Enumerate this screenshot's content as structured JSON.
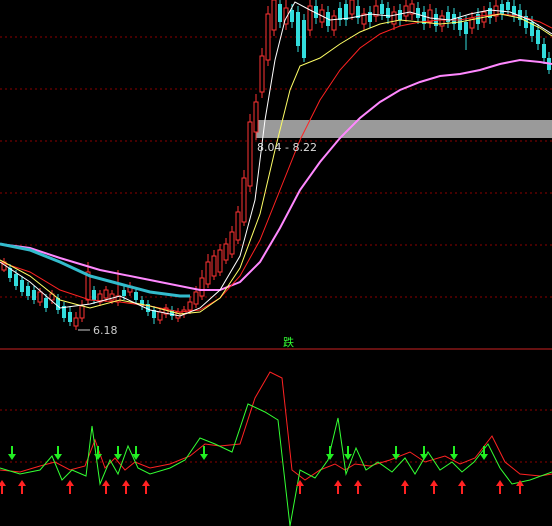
{
  "chart_data": [
    {
      "type": "candlestick",
      "panel": "price",
      "annotations": {
        "low_price_label": "6.18",
        "range_label": "8.04 - 8.22"
      },
      "colors": {
        "up": "#ff3333",
        "down": "#33dddd",
        "ma_fast": "#ffffff",
        "ma_mid": "#ffff66",
        "ma_slow": "#ff2222",
        "ma_long": "#ff88ff",
        "ma_ext": "#33bbcc",
        "grid": "#8b0000",
        "highlight_band": "#9a9a9a"
      }
    },
    {
      "type": "line",
      "panel": "indicator",
      "divider_label": "跌",
      "colors": {
        "line_a": "#33ff33",
        "line_b": "#ff2222",
        "arrow_up": "#ff2222",
        "arrow_down": "#22ee22"
      }
    }
  ]
}
